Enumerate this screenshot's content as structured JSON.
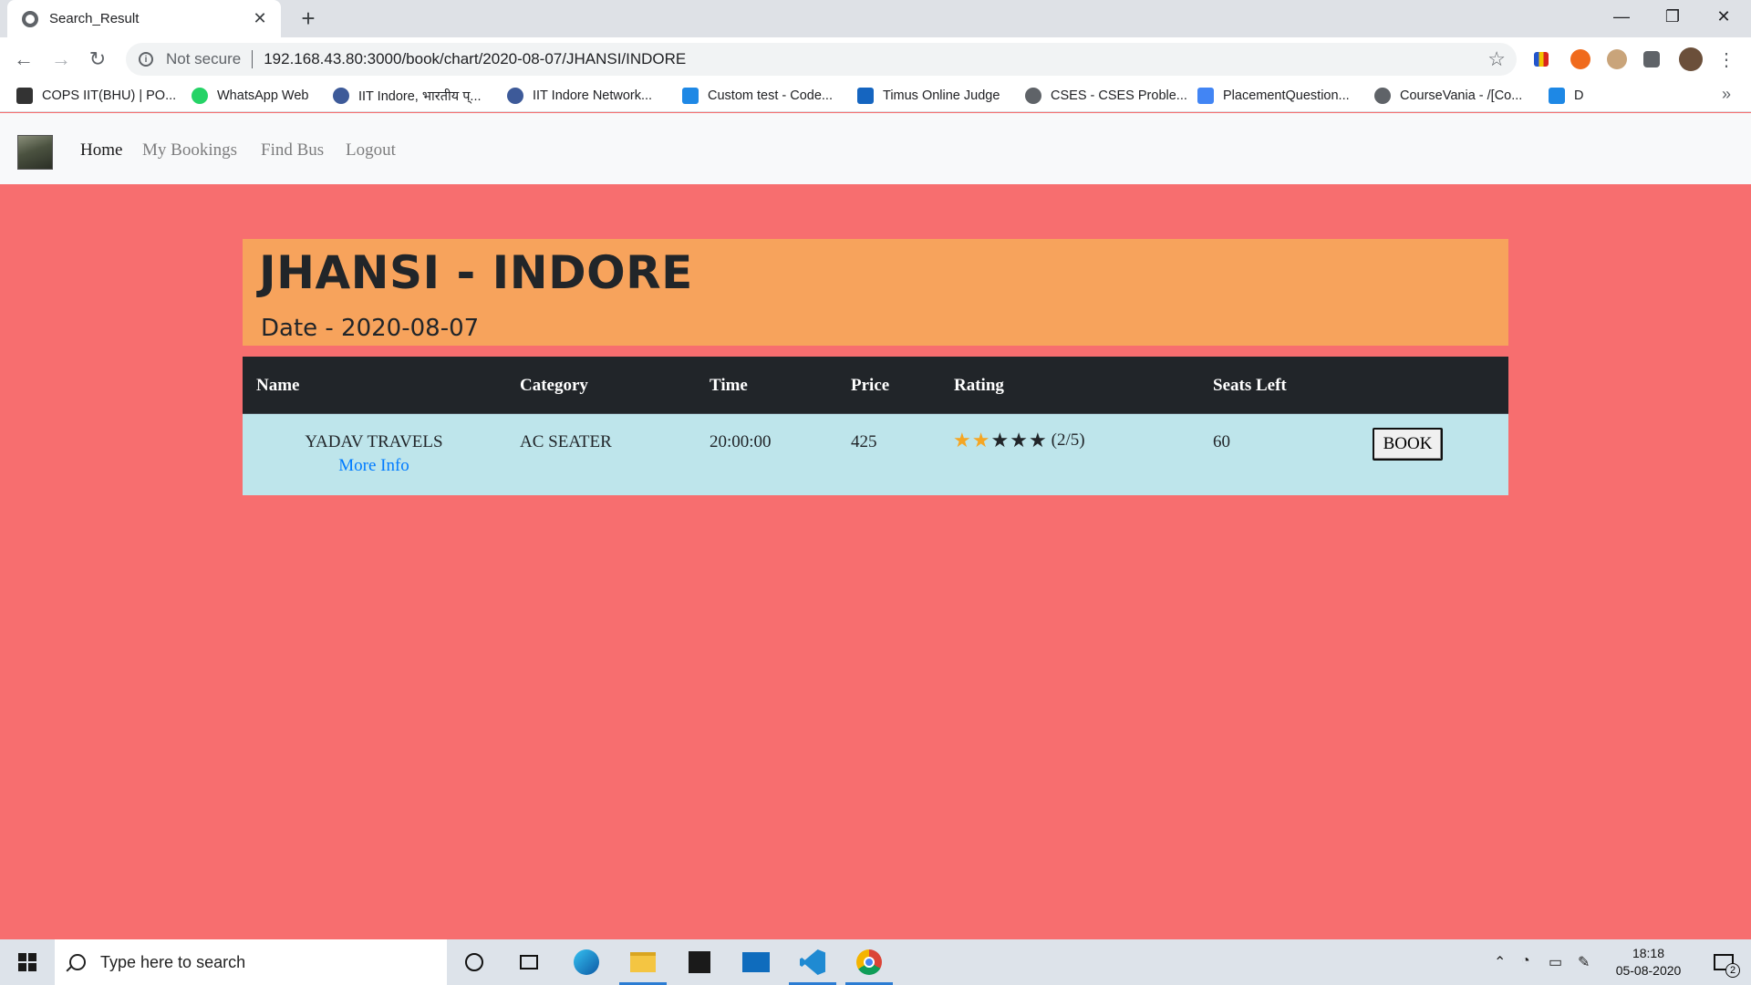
{
  "browser": {
    "tab_title": "Search_Result",
    "url_security": "Not secure",
    "url": "192.168.43.80:3000/book/chart/2020-08-07/JHANSI/INDORE",
    "bookmarks": [
      {
        "label": "COPS IIT(BHU) | PO...",
        "icon": "cops-icon",
        "color": "#333333"
      },
      {
        "label": "WhatsApp Web",
        "icon": "whatsapp-icon",
        "color": "#25d366"
      },
      {
        "label": "IIT Indore, भारतीय प्...",
        "icon": "iit-indore-icon",
        "color": "#3d5a99"
      },
      {
        "label": "IIT Indore Network...",
        "icon": "iit-network-icon",
        "color": "#3d5a99"
      },
      {
        "label": "Custom test - Code...",
        "icon": "codeforces-icon",
        "color": "#1e88e5"
      },
      {
        "label": "Timus Online Judge",
        "icon": "timus-icon",
        "color": "#1565c0"
      },
      {
        "label": "CSES - CSES Proble...",
        "icon": "globe-icon",
        "color": "#5f6368"
      },
      {
        "label": "PlacementQuestion...",
        "icon": "docs-icon",
        "color": "#4285f4"
      },
      {
        "label": "CourseVania - /[Co...",
        "icon": "globe-icon",
        "color": "#5f6368"
      },
      {
        "label": "D",
        "icon": "codeforces-icon",
        "color": "#1e88e5"
      }
    ]
  },
  "site": {
    "nav": [
      "Home",
      "My Bookings",
      "Find Bus",
      "Logout"
    ],
    "route_title": "JHANSI - INDORE",
    "date_label": "Date - 2020-08-07",
    "colors": {
      "page_bg": "#f76e6f",
      "header_bg": "#f7a35c",
      "table_head": "#212529",
      "row_bg": "#bee5eb",
      "star_on": "#f5a623"
    }
  },
  "table": {
    "headers": [
      "Name",
      "Category",
      "Time",
      "Price",
      "Rating",
      "Seats Left"
    ],
    "rows": [
      {
        "name": "YADAV TRAVELS",
        "more_info": "More Info",
        "category": "AC SEATER",
        "time": "20:00:00",
        "price": "425",
        "rating_value": 2,
        "rating_max": 5,
        "rating_label": "(2/5)",
        "seats_left": "60",
        "book_label": "BOOK"
      }
    ]
  },
  "taskbar": {
    "search_placeholder": "Type here to search",
    "time": "18:18",
    "date": "05-08-2020",
    "notification_count": "2"
  }
}
